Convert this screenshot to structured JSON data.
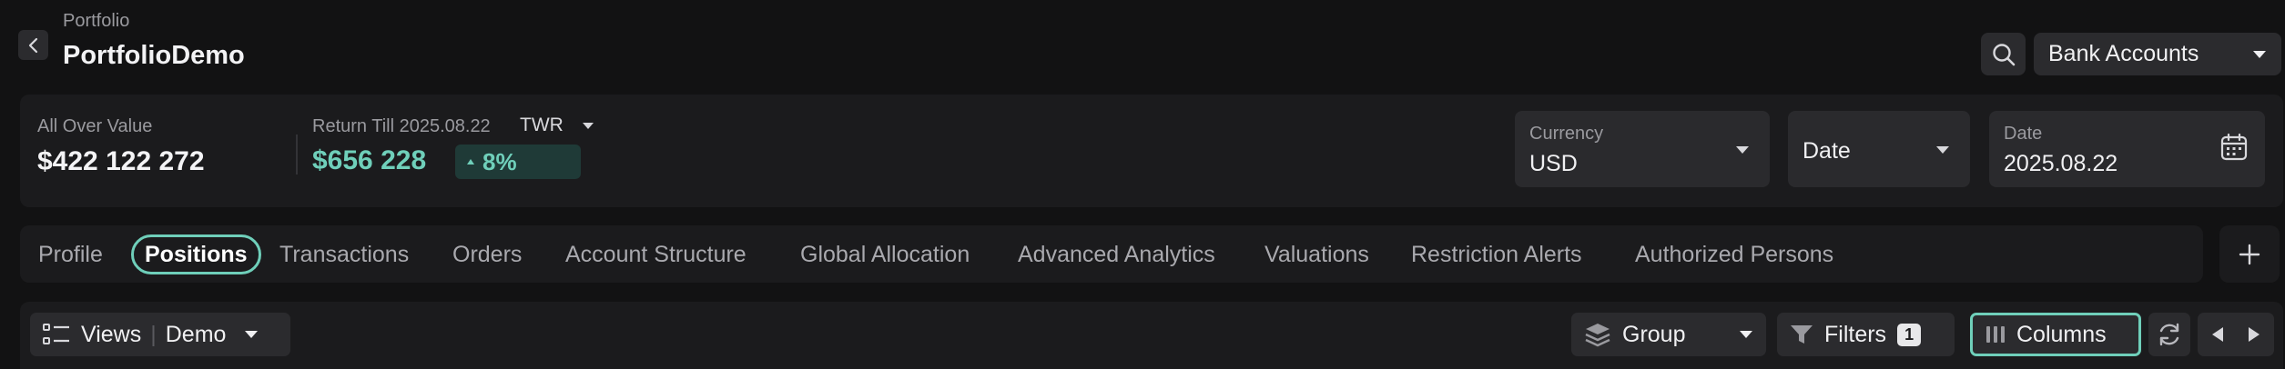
{
  "header": {
    "breadcrumb": "Portfolio",
    "title": "PortfolioDemo",
    "account_select": "Bank Accounts"
  },
  "summary": {
    "all_over_value_label": "All Over Value",
    "all_over_value": "$422 122 272",
    "return_label": "Return Till 2025.08.22",
    "return_method": "TWR",
    "return_value": "$656 228",
    "return_pct": "8%",
    "currency_label": "Currency",
    "currency_value": "USD",
    "date_type": "Date",
    "date_label": "Date",
    "date_value": "2025.08.22"
  },
  "tabs": [
    {
      "label": "Profile"
    },
    {
      "label": "Positions",
      "active": true
    },
    {
      "label": "Transactions"
    },
    {
      "label": "Orders"
    },
    {
      "label": "Account Structure"
    },
    {
      "label": "Global Allocation"
    },
    {
      "label": "Advanced Analytics"
    },
    {
      "label": "Valuations"
    },
    {
      "label": "Restriction Alerts"
    },
    {
      "label": "Authorized Persons"
    }
  ],
  "toolbar": {
    "views_label": "Views",
    "views_value": "Demo",
    "group_label": "Group",
    "filters_label": "Filters",
    "filters_count": "1",
    "columns_label": "Columns"
  },
  "colors": {
    "background": "#121213",
    "card": "#1b1b1d",
    "control": "#2b2b2e",
    "accent": "#6fcfba",
    "accent_bg": "#1f3a37"
  }
}
